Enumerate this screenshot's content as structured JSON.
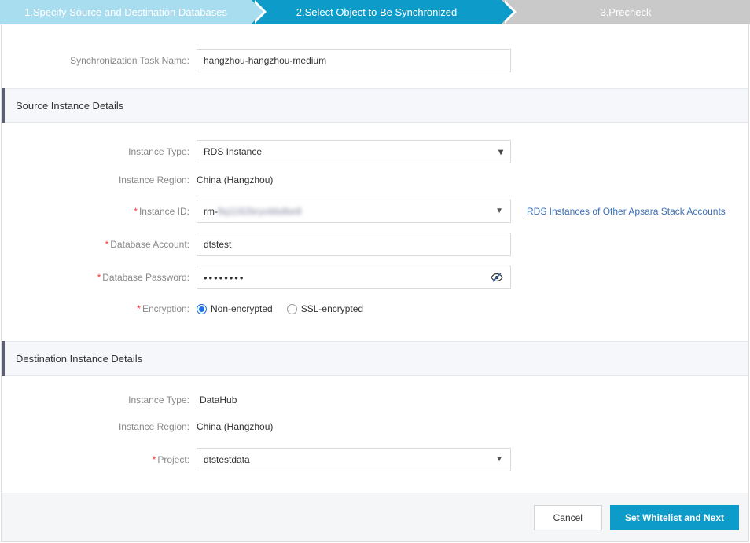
{
  "steps": [
    {
      "label": "1.Specify Source and Destination Databases",
      "state": "done"
    },
    {
      "label": "2.Select Object to Be Synchronized",
      "state": "active"
    },
    {
      "label": "3.Precheck",
      "state": "upcoming"
    }
  ],
  "task_name": {
    "label": "Synchronization Task Name:",
    "value": "hangzhou-hangzhou-medium"
  },
  "source": {
    "section_title": "Source Instance Details",
    "instance_type": {
      "label": "Instance Type:",
      "value": "RDS Instance"
    },
    "instance_region": {
      "label": "Instance Region:",
      "value": "China (Hangzhou)"
    },
    "instance_id": {
      "label": "Instance ID:",
      "required": "*",
      "value_prefix": "rm-",
      "value_redacted": "9q1162bryvbbdbe8",
      "link": "RDS Instances of Other Apsara Stack Accounts"
    },
    "database_account": {
      "label": "Database Account:",
      "required": "*",
      "value": "dtstest"
    },
    "database_password": {
      "label": "Database Password:",
      "required": "*",
      "value_masked": "••••••••",
      "toggle_icon": "eye-slash-icon"
    },
    "encryption": {
      "label": "Encryption:",
      "required": "*",
      "options": [
        {
          "label": "Non-encrypted",
          "selected": true
        },
        {
          "label": "SSL-encrypted",
          "selected": false
        }
      ]
    }
  },
  "destination": {
    "section_title": "Destination Instance Details",
    "instance_type": {
      "label": "Instance Type:",
      "value": "DataHub"
    },
    "instance_region": {
      "label": "Instance Region:",
      "value": "China (Hangzhou)"
    },
    "project": {
      "label": "Project:",
      "required": "*",
      "value": "dtstestdata"
    }
  },
  "footer": {
    "cancel_label": "Cancel",
    "next_label": "Set Whitelist and Next"
  },
  "colors": {
    "step_done": "#a8dcef",
    "step_active": "#0d9cc9",
    "step_upcoming": "#c9c9c9",
    "primary": "#0d9cc9",
    "required_star": "#ff3333",
    "link": "#3b6fb6",
    "section_accent": "#5b6073",
    "radio_selected": "#1a73e8"
  }
}
